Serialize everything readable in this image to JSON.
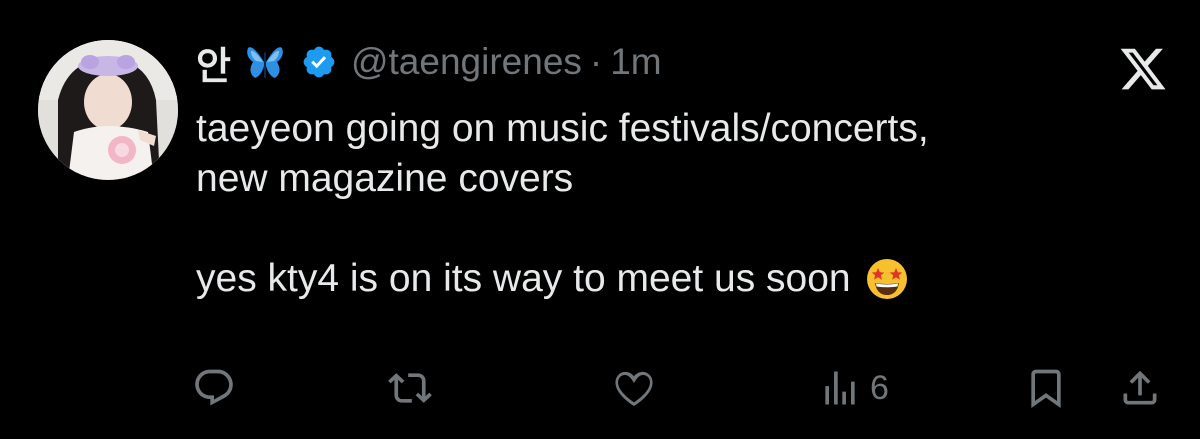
{
  "author": {
    "display_name": "안",
    "handle": "@taengirenes",
    "separator": "·",
    "timestamp": "1m",
    "verified": true,
    "name_emoji": "blue-butterfly-icon"
  },
  "tweet": {
    "line1": "taeyeon going on music festivals/concerts,",
    "line2": "new magazine covers",
    "line3": "yes kty4 is on its way to meet us soon",
    "trailing_emoji": "star-struck-emoji"
  },
  "actions": {
    "reply": {
      "icon": "reply-icon",
      "count": ""
    },
    "repost": {
      "icon": "repost-icon",
      "count": ""
    },
    "like": {
      "icon": "heart-icon",
      "count": ""
    },
    "views": {
      "icon": "views-icon",
      "count": "6"
    },
    "bookmark": {
      "icon": "bookmark-icon"
    },
    "share": {
      "icon": "share-icon"
    }
  },
  "brand": {
    "logo": "x-logo-icon"
  },
  "colors": {
    "background": "#000000",
    "text": "#e7e9ea",
    "secondary": "#71767b",
    "verified": "#1d9bf0"
  }
}
